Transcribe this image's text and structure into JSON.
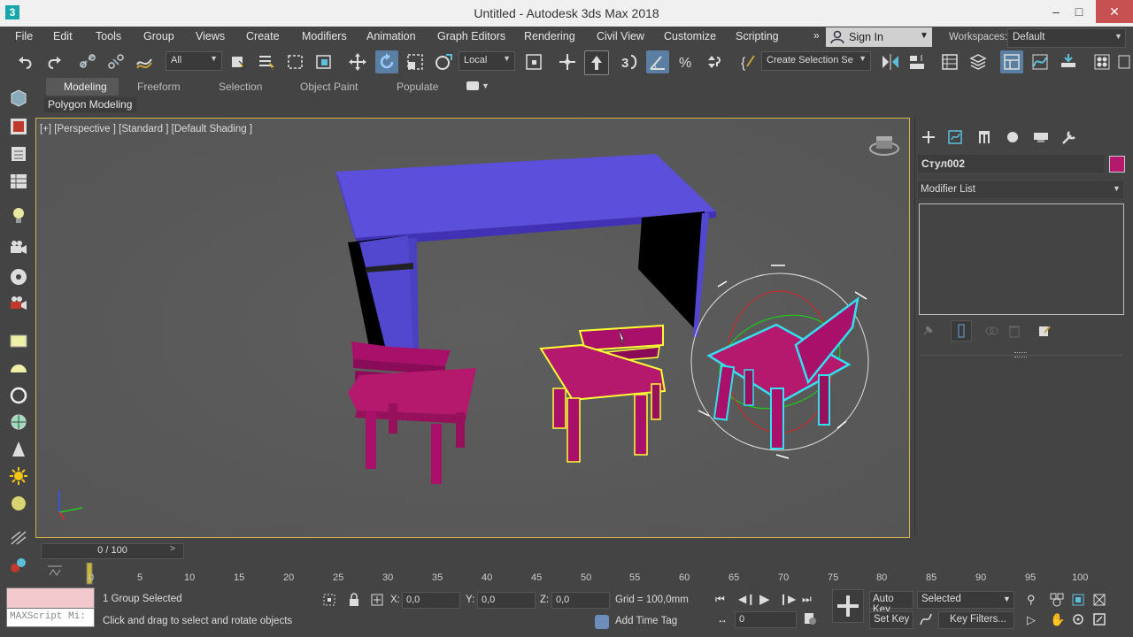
{
  "window": {
    "title": "Untitled - Autodesk 3ds Max 2018",
    "app_icon": "3"
  },
  "menu": [
    "File",
    "Edit",
    "Tools",
    "Group",
    "Views",
    "Create",
    "Modifiers",
    "Animation",
    "Graph Editors",
    "Rendering",
    "Civil View",
    "Customize",
    "Scripting"
  ],
  "signin": {
    "label": "Sign In"
  },
  "workspaces": {
    "label": "Workspaces:",
    "value": "Default"
  },
  "toolbar": {
    "selection_filter": "All",
    "ref_coord": "Local",
    "named_selection": "Create Selection Se"
  },
  "ribbon": {
    "tabs": [
      "Modeling",
      "Freeform",
      "Selection",
      "Object Paint",
      "Populate"
    ],
    "active_tab": "Modeling",
    "panel_label": "Polygon Modeling"
  },
  "viewport": {
    "label": "[+] [Perspective ] [Standard ] [Default Shading ]"
  },
  "command_panel": {
    "object_name": "Стул002",
    "object_color": "#b4196e",
    "modifier_list": "Modifier List"
  },
  "timeline": {
    "slider": "0 / 100",
    "ticks": [
      "0",
      "5",
      "10",
      "15",
      "20",
      "25",
      "30",
      "35",
      "40",
      "45",
      "50",
      "55",
      "60",
      "65",
      "70",
      "75",
      "80",
      "85",
      "90",
      "95",
      "100"
    ]
  },
  "status": {
    "maxscript": "MAXScript Mi:",
    "selection": "1 Group Selected",
    "prompt": "Click and drag to select and rotate objects",
    "x_label": "X:",
    "x": "0,0",
    "y_label": "Y:",
    "y": "0,0",
    "z_label": "Z:",
    "z": "0,0",
    "grid": "Grid = 100,0mm",
    "add_time_tag": "Add Time Tag",
    "auto_key": "Auto Key",
    "set_key": "Set Key",
    "key_mode": "Selected",
    "frame": "0",
    "key_filters": "Key Filters..."
  }
}
